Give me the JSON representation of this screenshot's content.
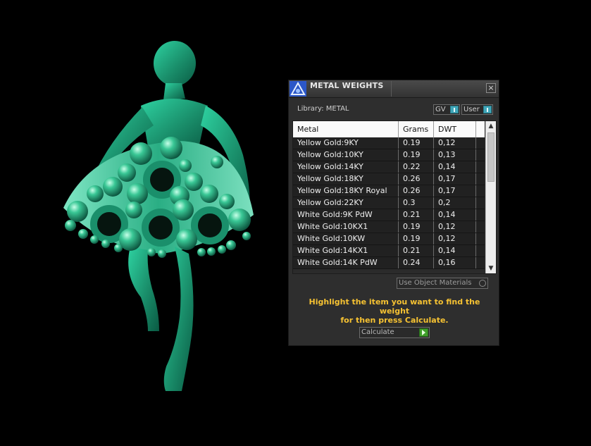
{
  "panel": {
    "title": "METAL WEIGHTS",
    "close_label": "×",
    "library_label": "Library: METAL",
    "toggle_gv": "GV",
    "toggle_user": "User"
  },
  "table": {
    "headers": [
      "Metal",
      "Grams",
      "DWT",
      ""
    ],
    "rows": [
      {
        "metal": "Yellow Gold:9KY",
        "grams": "0.19",
        "dwt": "0,12"
      },
      {
        "metal": "Yellow Gold:10KY",
        "grams": "0.19",
        "dwt": "0,13"
      },
      {
        "metal": "Yellow Gold:14KY",
        "grams": "0.22",
        "dwt": "0,14"
      },
      {
        "metal": "Yellow Gold:18KY",
        "grams": "0.26",
        "dwt": "0,17"
      },
      {
        "metal": "Yellow Gold:18KY Royal",
        "grams": "0.26",
        "dwt": "0,17"
      },
      {
        "metal": "Yellow Gold:22KY",
        "grams": "0.3",
        "dwt": "0,2"
      },
      {
        "metal": "White Gold:9K PdW",
        "grams": "0.21",
        "dwt": "0,14"
      },
      {
        "metal": "White Gold:10KX1",
        "grams": "0.19",
        "dwt": "0,12"
      },
      {
        "metal": "White Gold:10KW",
        "grams": "0.19",
        "dwt": "0,12"
      },
      {
        "metal": "White Gold:14KX1",
        "grams": "0.21",
        "dwt": "0,14"
      },
      {
        "metal": "White Gold:14K PdW",
        "grams": "0.24",
        "dwt": "0,16"
      }
    ]
  },
  "options": {
    "use_object_materials": "Use Object Materials"
  },
  "hint": {
    "line1": "Highlight the item you want to find the weight",
    "line2": "for then press Calculate."
  },
  "actions": {
    "calculate_label": "Calculate"
  },
  "icons": {
    "logo": "app-logo-icon",
    "close": "close-icon",
    "scroll_up": "chevron-up-icon",
    "scroll_down": "chevron-down-icon",
    "calculate": "play-icon"
  },
  "colors": {
    "hint_text": "#f6c232",
    "toggle_knob": "#3fa6b8",
    "calculate_play": "#3f9f2a",
    "jewel_green": "#2fb98a"
  }
}
